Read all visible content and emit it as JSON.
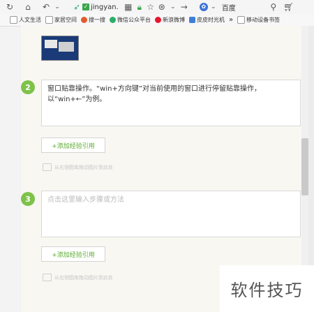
{
  "toolbar": {
    "url_text": "jingyan.",
    "search_label": "百度",
    "more_label": "»"
  },
  "bookmarks": [
    {
      "label": "人文生活",
      "color": "#9a9a9a"
    },
    {
      "label": "家居空间",
      "color": "#9a9a9a"
    },
    {
      "label": "搜一搜",
      "color": "#e35b2b"
    },
    {
      "label": "微信公众平台",
      "color": "#2aae67"
    },
    {
      "label": "新浪微博",
      "color": "#e6162d"
    },
    {
      "label": "皮皮时光机",
      "color": "#3d7fd6"
    },
    {
      "label": "移动设备书签",
      "color": "#9a9a9a"
    }
  ],
  "steps": [
    {
      "number": "2",
      "text": "窗口贴靠操作。“win+方向键”对当前使用的窗口进行停留贴靠操作，以“win+←”为例。",
      "add_button": "+添加经验引用",
      "drag_hint": "从右侧图库拖动图片到此处"
    },
    {
      "number": "3",
      "placeholder": "点击这里输入步骤或方法",
      "add_button": "+添加经验引用",
      "drag_hint": "从右侧图库拖动图片到此处"
    }
  ],
  "watermark": "软件技巧"
}
